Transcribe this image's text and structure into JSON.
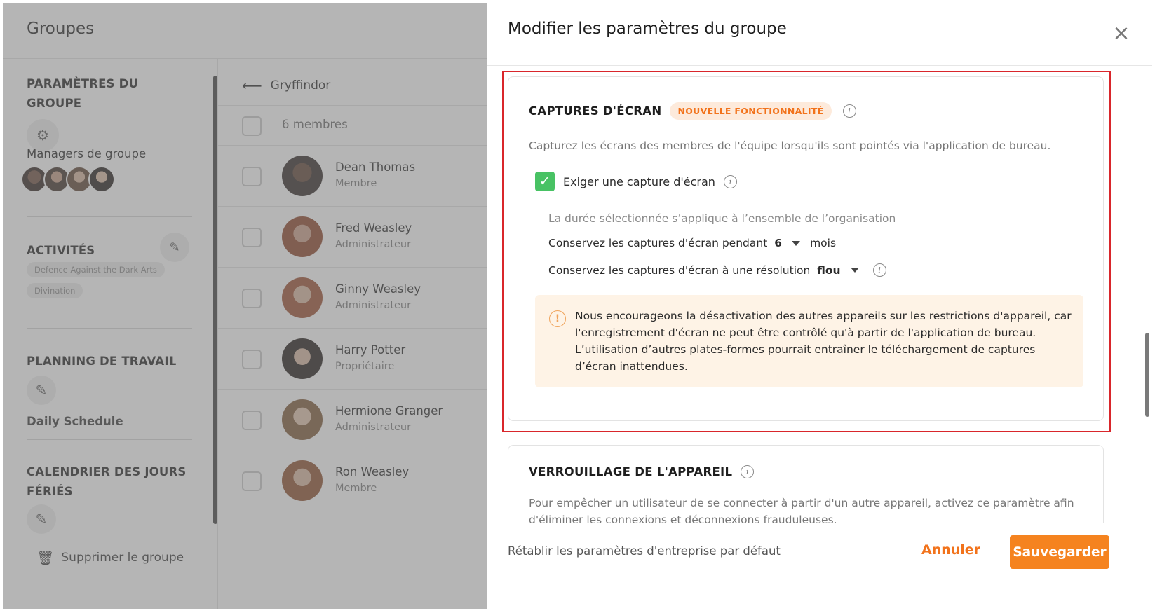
{
  "left": {
    "title": "Groupes",
    "sections": {
      "group_settings": "PARAMÈTRES DU GROUPE",
      "group_managers": "Managers de groupe",
      "activities": "ACTIVITÉS",
      "activity_tags": [
        "Defence Against the Dark Arts",
        "Divination"
      ],
      "work_schedule": "PLANNING DE TRAVAIL",
      "schedule_name": "Daily Schedule",
      "holidays": "CALENDRIER DES JOURS FÉRIÉS",
      "delete_group": "Supprimer le groupe"
    },
    "members": {
      "breadcrumb": "Gryffindor",
      "count_label": "6 membres",
      "rows": [
        {
          "name": "Dean Thomas",
          "role": "Membre"
        },
        {
          "name": "Fred Weasley",
          "role": "Administrateur"
        },
        {
          "name": "Ginny Weasley",
          "role": "Administrateur"
        },
        {
          "name": "Harry Potter",
          "role": "Propriétaire"
        },
        {
          "name": "Hermione Granger",
          "role": "Administrateur"
        },
        {
          "name": "Ron Weasley",
          "role": "Membre"
        }
      ]
    }
  },
  "modal": {
    "title": "Modifier les paramètres du groupe",
    "screenshots": {
      "title": "CAPTURES D'ÉCRAN",
      "badge": "NOUVELLE FONCTIONNALITÉ",
      "description": "Capturez les écrans des membres de l'équipe lorsqu'ils sont pointés via l'application de bureau.",
      "require_label": "Exiger une capture d'écran",
      "require_checked": true,
      "scope_note": "La durée sélectionnée s’applique à l’ensemble de l’organisation",
      "retention_label": "Conservez les captures d'écran pendant",
      "retention_value": "6",
      "retention_unit": "mois",
      "resolution_label": "Conservez les captures d'écran à une résolution",
      "resolution_value": "flou",
      "warning": "Nous encourageons la désactivation des autres appareils sur les restrictions d'appareil, car l'enregistrement d'écran ne peut être contrôlé qu'à partir de l'application de bureau. L’utilisation d’autres plates-formes pourrait entraîner le téléchargement de captures d’écran inattendues."
    },
    "device_lock": {
      "title": "VERROUILLAGE DE L'APPAREIL",
      "description": "Pour empêcher un utilisateur de se connecter à partir d'un autre appareil, activez ce paramètre afin d'éliminer les connexions et déconnexions frauduleuses."
    },
    "footer": {
      "reset": "Rétablir les paramètres d'entreprise par défaut",
      "cancel": "Annuler",
      "save": "Sauvegarder"
    }
  },
  "colors": {
    "accent": "#f5831f",
    "check_green": "#48c264",
    "highlight_red": "#d9262b",
    "warning_bg": "#fef3e6"
  },
  "icons": [
    "gear-icon",
    "pencil-icon",
    "trash-icon",
    "arrow-left-icon",
    "close-icon",
    "info-icon",
    "warning-icon",
    "check-icon",
    "caret-down-icon"
  ]
}
